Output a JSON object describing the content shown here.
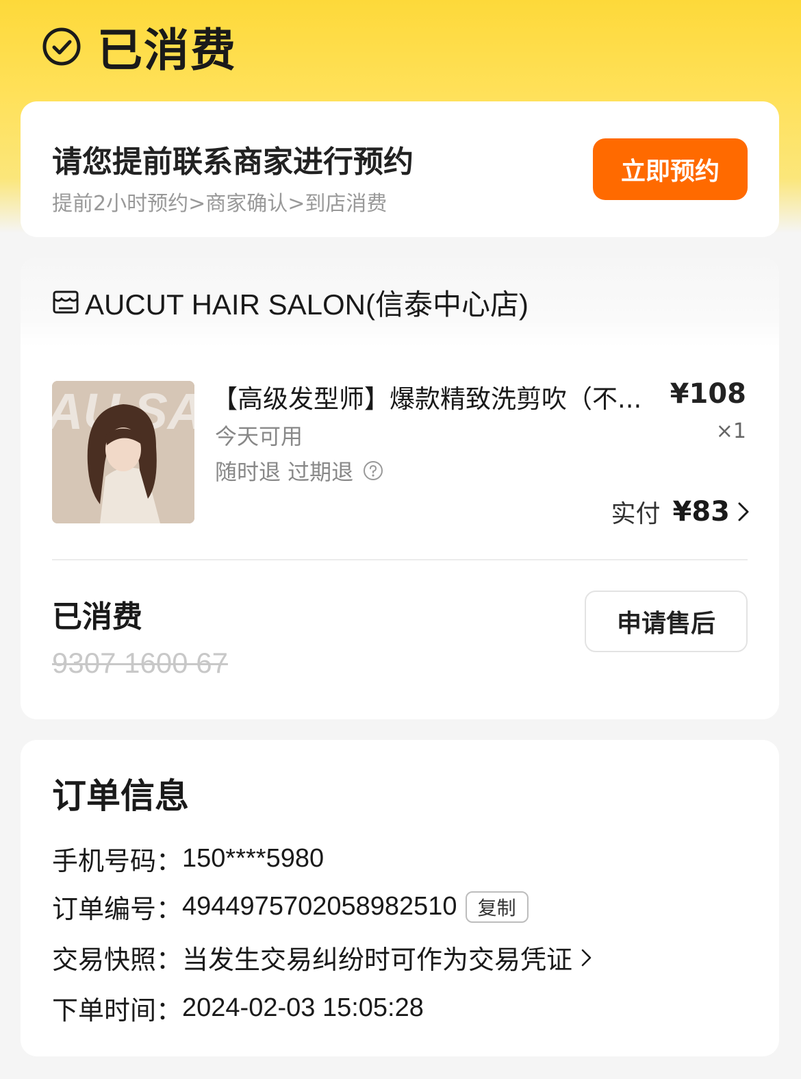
{
  "status": {
    "title": "已消费",
    "icon": "check-circle-icon"
  },
  "reservation": {
    "title": "请您提前联系商家进行预约",
    "steps": "提前2小时预约>商家确认>到店消费",
    "button_label": "立即预约",
    "button_color": "#ff6a00"
  },
  "shop": {
    "icon": "store-icon",
    "name": "AUCUT HAIR SALON(信泰中心店)"
  },
  "product": {
    "name": "【高级发型师】爆款精致洗剪吹（不...",
    "price": "¥108",
    "quantity": "×1",
    "availability": "今天可用",
    "refund_policy": "随时退  过期退",
    "paid_label": "实付",
    "paid_value": "¥83"
  },
  "voucher": {
    "status": "已消费",
    "code": "9307 1600 67",
    "after_sale_label": "申请售后"
  },
  "order_info": {
    "title": "订单信息",
    "phone_label": "手机号码：",
    "phone_value": "150****5980",
    "order_no_label": "订单编号：",
    "order_no_value": "4944975702058982510",
    "copy_label": "复制",
    "snapshot_label": "交易快照：",
    "snapshot_value": "当发生交易纠纷时可作为交易凭证",
    "time_label": "下单时间：",
    "time_value": "2024-02-03 15:05:28"
  }
}
